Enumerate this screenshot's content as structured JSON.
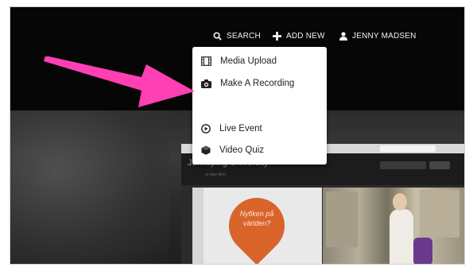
{
  "nav": {
    "search_label": "SEARCH",
    "add_new_label": "ADD NEW",
    "user_label": "JENNY MADSEN"
  },
  "menu": {
    "items": [
      {
        "label": "Media Upload",
        "icon": "film-icon"
      },
      {
        "label": "Make A Recording",
        "icon": "camera-icon"
      },
      {
        "label": "Live Event",
        "icon": "play-circle-icon"
      },
      {
        "label": "Video Quiz",
        "icon": "cube-icon"
      }
    ]
  },
  "preview": {
    "title": "Jonkoping University",
    "subtitle": "ur jasy dent",
    "bubble_text": "Nyfiken på världen?"
  },
  "colors": {
    "annotation_arrow": "#ff3fb4",
    "background": "#060606",
    "menu_background": "#ffffff",
    "bubble": "#d9642a"
  }
}
